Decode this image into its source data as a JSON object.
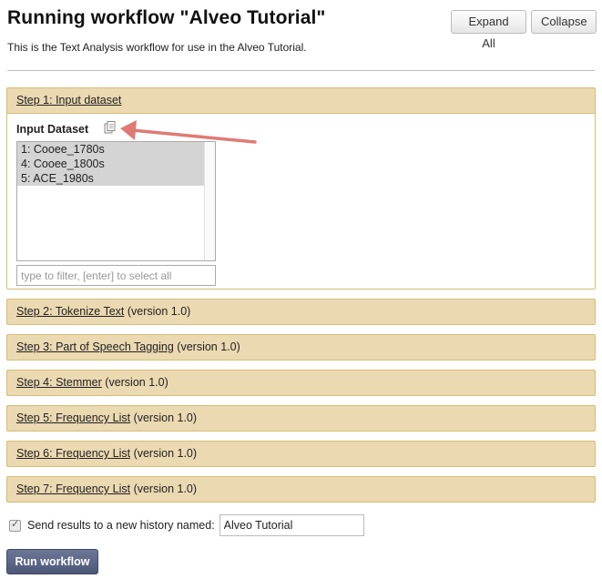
{
  "header": {
    "title": "Running workflow \"Alveo Tutorial\"",
    "description": "This is the Text Analysis workflow for use in the Alveo Tutorial.",
    "expand_all_label": "Expand All",
    "collapse_label": "Collapse"
  },
  "step1": {
    "title": "Step 1: Input dataset",
    "field_label": "Input Dataset",
    "datasets": [
      "1: Cooee_1780s",
      "4: Cooee_1800s",
      "5: ACE_1980s"
    ],
    "filter_placeholder": "type to filter, [enter] to select all"
  },
  "steps": [
    {
      "title": "Step 2: Tokenize Text",
      "version": "(version 1.0)"
    },
    {
      "title": "Step 3: Part of Speech Tagging",
      "version": "(version 1.0)"
    },
    {
      "title": "Step 4: Stemmer",
      "version": "(version 1.0)"
    },
    {
      "title": "Step 5: Frequency List",
      "version": "(version 1.0)"
    },
    {
      "title": "Step 6: Frequency List",
      "version": "(version 1.0)"
    },
    {
      "title": "Step 7: Frequency List",
      "version": "(version 1.0)"
    }
  ],
  "send_results": {
    "label": "Send results to a new history named:",
    "checked": true,
    "history_name": "Alveo Tutorial"
  },
  "run_button_label": "Run workflow",
  "colors": {
    "step_header_bg": "#ebd9b2",
    "step_border": "#d6be73",
    "run_button": "#5a6585",
    "annotation_arrow": "#e07a74"
  },
  "icons": {
    "copy": "copy-datasets-icon",
    "checkbox": "checkmark-icon"
  }
}
